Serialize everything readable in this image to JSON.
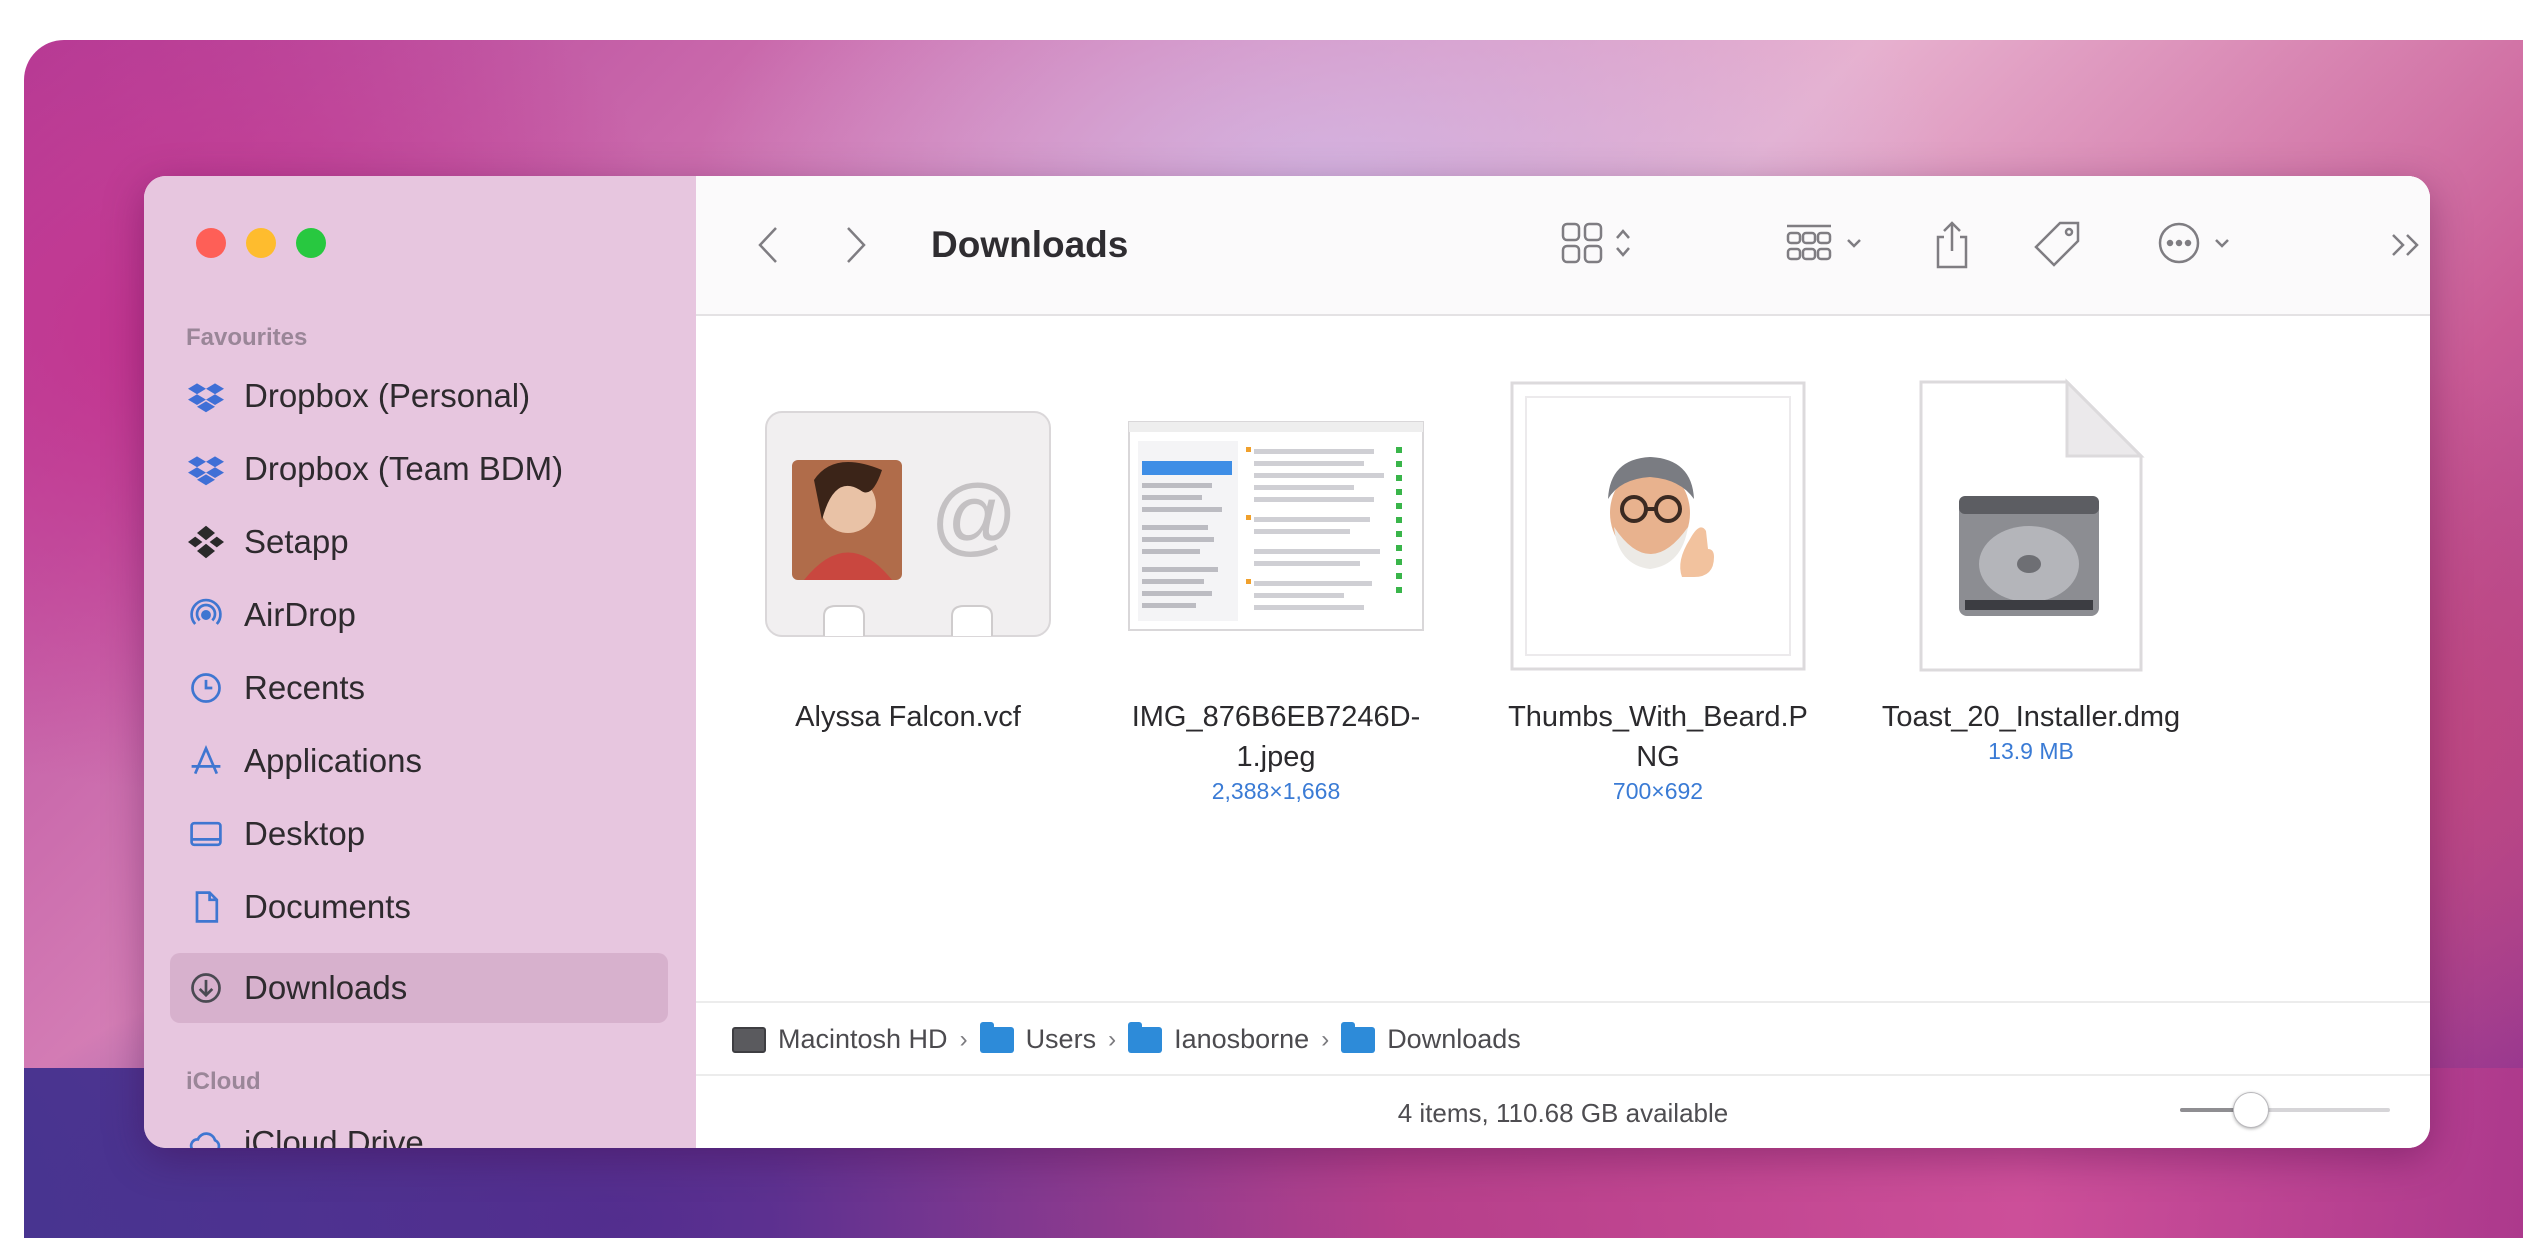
{
  "window": {
    "title": "Downloads"
  },
  "sidebar": {
    "sections": [
      {
        "label": "Favourites",
        "items": [
          {
            "label": "Dropbox (Personal)",
            "icon": "dropbox-icon"
          },
          {
            "label": "Dropbox (Team BDM)",
            "icon": "dropbox-icon"
          },
          {
            "label": "Setapp",
            "icon": "setapp-icon"
          },
          {
            "label": "AirDrop",
            "icon": "airdrop-icon"
          },
          {
            "label": "Recents",
            "icon": "clock-icon"
          },
          {
            "label": "Applications",
            "icon": "applications-icon"
          },
          {
            "label": "Desktop",
            "icon": "desktop-icon"
          },
          {
            "label": "Documents",
            "icon": "document-icon"
          },
          {
            "label": "Downloads",
            "icon": "download-icon",
            "selected": true
          }
        ]
      },
      {
        "label": "iCloud",
        "items": [
          {
            "label": "iCloud Drive",
            "icon": "icloud-icon"
          }
        ]
      }
    ]
  },
  "toolbar": {
    "back": "back-chevron-icon",
    "forward": "forward-chevron-icon",
    "icon_view": "icon-grid-icon",
    "group": "group-icon",
    "share": "share-icon",
    "tag": "tag-icon",
    "more": "ellipsis-circle-icon",
    "overflow": "double-chevron-icon",
    "search": "search-icon"
  },
  "files": [
    {
      "name": "Alyssa Falcon.vcf",
      "meta": "",
      "kind": "contact-card"
    },
    {
      "name": "IMG_876B6EB7246D-1.jpeg",
      "meta": "2,388×1,668",
      "kind": "screenshot-image"
    },
    {
      "name": "Thumbs_With_Beard.PNG",
      "meta": "700×692",
      "kind": "memoji-image"
    },
    {
      "name": "Toast_20_Installer.dmg",
      "meta": "13.9 MB",
      "kind": "disk-image"
    }
  ],
  "pathbar": {
    "segments": [
      "Macintosh HD",
      "Users",
      "Ianosborne",
      "Downloads"
    ],
    "separator": "›"
  },
  "statusbar": {
    "text": "4 items, 110.68 GB available",
    "zoom_level": 0.3
  },
  "colors": {
    "sidebar_bg": "#e7c6df",
    "selection": "#d7b1cd",
    "accent_text": "#3a7bd5"
  }
}
